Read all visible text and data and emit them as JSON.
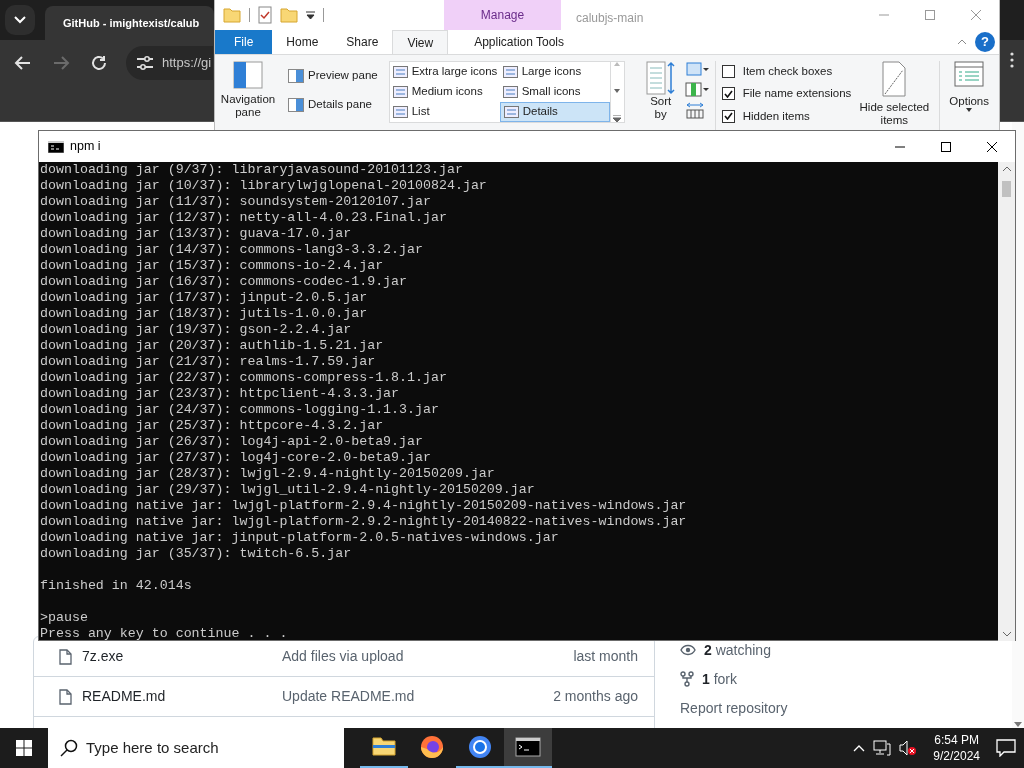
{
  "browser": {
    "tab_title": "GitHub - imightexist/calub",
    "url": "https://gi",
    "back_disabled": false,
    "forward_disabled": true,
    "files": [
      {
        "name": "7z.exe",
        "message": "Add files via upload",
        "time": "last month"
      },
      {
        "name": "README.md",
        "message": "Update README.md",
        "time": "2 months ago"
      }
    ],
    "sidebar": [
      {
        "kind": "watching",
        "text": "**2** watching"
      },
      {
        "kind": "fork",
        "text": "**1** fork"
      },
      {
        "kind": "link",
        "text": "Report repository"
      }
    ]
  },
  "explorer": {
    "title": "calubjs-main",
    "context_tab": "Manage",
    "help": "?",
    "tabs": [
      {
        "label": "File",
        "kind": "file",
        "selected": false
      },
      {
        "label": "Home",
        "kind": "plain",
        "selected": false
      },
      {
        "label": "Share",
        "kind": "plain",
        "selected": false
      },
      {
        "label": "View",
        "kind": "plain",
        "selected": true
      },
      {
        "label": "Application Tools",
        "kind": "context",
        "selected": false
      }
    ],
    "panes": {
      "navigation": "Navigation pane",
      "preview": "Preview pane",
      "details": "Details pane"
    },
    "layouts": [
      {
        "label": "Extra large icons",
        "selected": false
      },
      {
        "label": "Large icons",
        "selected": false
      },
      {
        "label": "Medium icons",
        "selected": false
      },
      {
        "label": "Small icons",
        "selected": false
      },
      {
        "label": "List",
        "selected": false
      },
      {
        "label": "Details",
        "selected": true
      }
    ],
    "sort": "Sort by",
    "checkboxes": [
      {
        "label": "Item check boxes",
        "checked": false
      },
      {
        "label": "File name extensions",
        "checked": true
      },
      {
        "label": "Hidden items",
        "checked": true
      }
    ],
    "hide": "Hide selected items",
    "options": "Options"
  },
  "terminal": {
    "title": "npm i",
    "blocks": [
      [
        "downloading jar (9/37): libraryjavasound-20101123.jar",
        "downloading jar (10/37): librarylwjglopenal-20100824.jar",
        "downloading jar (11/37): soundsystem-20120107.jar",
        "downloading jar (12/37): netty-all-4.0.23.Final.jar",
        "downloading jar (13/37): guava-17.0.jar",
        "downloading jar (14/37): commons-lang3-3.3.2.jar",
        "downloading jar (15/37): commons-io-2.4.jar",
        "downloading jar (16/37): commons-codec-1.9.jar",
        "downloading jar (17/37): jinput-2.0.5.jar",
        "downloading jar (18/37): jutils-1.0.0.jar",
        "downloading jar (19/37): gson-2.2.4.jar",
        "downloading jar (20/37): authlib-1.5.21.jar",
        "downloading jar (21/37): realms-1.7.59.jar",
        "downloading jar (22/37): commons-compress-1.8.1.jar",
        "downloading jar (23/37): httpclient-4.3.3.jar",
        "downloading jar (24/37): commons-logging-1.1.3.jar",
        "downloading jar (25/37): httpcore-4.3.2.jar",
        "downloading jar (26/37): log4j-api-2.0-beta9.jar",
        "downloading jar (27/37): log4j-core-2.0-beta9.jar",
        "downloading jar (28/37): lwjgl-2.9.4-nightly-20150209.jar",
        "downloading jar (29/37): lwjgl_util-2.9.4-nightly-20150209.jar",
        "downloading native jar: lwjgl-platform-2.9.4-nightly-20150209-natives-windows.jar",
        "downloading native jar: lwjgl-platform-2.9.2-nightly-20140822-natives-windows.jar",
        "downloading native jar: jinput-platform-2.0.5-natives-windows.jar",
        "downloading jar (35/37): twitch-6.5.jar"
      ],
      [
        "finished in 42.014s"
      ],
      [
        ">pause",
        "Press any key to continue . . ."
      ]
    ]
  },
  "taskbar": {
    "search": {
      "placeholder": "Type here to search"
    },
    "apps": [
      {
        "kind": "explorer",
        "running": true,
        "selected": false
      },
      {
        "kind": "firefox",
        "running": false,
        "selected": false
      },
      {
        "kind": "chrome",
        "running": true,
        "selected": false
      },
      {
        "kind": "terminal",
        "running": true,
        "selected": true
      }
    ],
    "time": "6:54 PM",
    "date": "9/2/2024"
  }
}
